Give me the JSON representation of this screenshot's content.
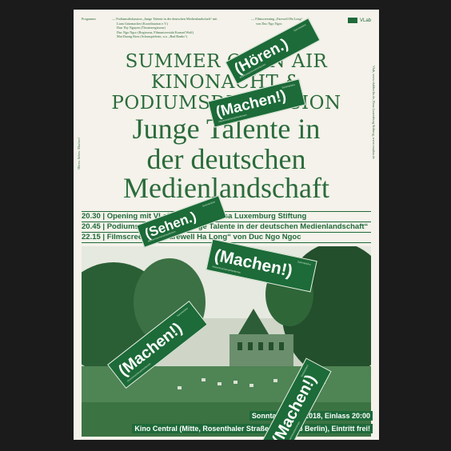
{
  "header": {
    "programm_label": "Programm",
    "program_lines": [
      "— Podiumsdiskussion „Junge Talente in der deutschen Medienlandschaft“ mit",
      "Liam Gräzmacher (Koordination e.V.)",
      "Dan Thy Nguyen (Theaterregisseur)",
      "Duc Ngo Ngoc (Regisseur, Filmuniversität Konrad Wolf)",
      "Mai Duong Kieu (Schauspielerin, u.a. „Bad Banks“)"
    ],
    "film_lines": [
      "— Filmscreening „Farewell Ha Long“",
      "von Duc Ngo Ngoc"
    ],
    "logo_text": "VLab"
  },
  "side_left": "Hören. Sehen. Machen!",
  "side_right": "Vlab, www.vlabberlin.de, Rosa Luxemburg Stiftung, www.rosalux.de",
  "headline": {
    "line1": "SUMMER OPEN AIR",
    "line2": "KINONACHT &",
    "line3": "PODIUMSDISKUSSION",
    "line4": "Junge Talente in",
    "line5": "der deutschen",
    "line6": "Medienlandschaft"
  },
  "schedule": [
    "20.30 | Opening mit VLab Berlin und Rosa Luxemburg Stiftung",
    "20.45 | Podiumsdiskussion „Junge Talente in der deutschen Medienlandschaft“",
    "22.15 | Filmscreening „Farewell Ha Long“ von Duc Ngo Ngoc"
  ],
  "footer": {
    "line1": "Sonntag, 08.07.2018, Einlass 20:00",
    "line2": "Kino Central (Mitte, Rosenthaler Straße 39, 10178 Berlin), Eintritt frei!"
  },
  "stickers": {
    "hoeren": "(Hören.)",
    "machen": "(Machen!)",
    "sehen": "(Sehen.)",
    "fine": "#horenmachensehenlernen",
    "hash": "Sommerkino"
  },
  "colors": {
    "brand_green": "#1f6a3a",
    "paper": "#f4f2ea",
    "background": "#1b1b1b"
  }
}
